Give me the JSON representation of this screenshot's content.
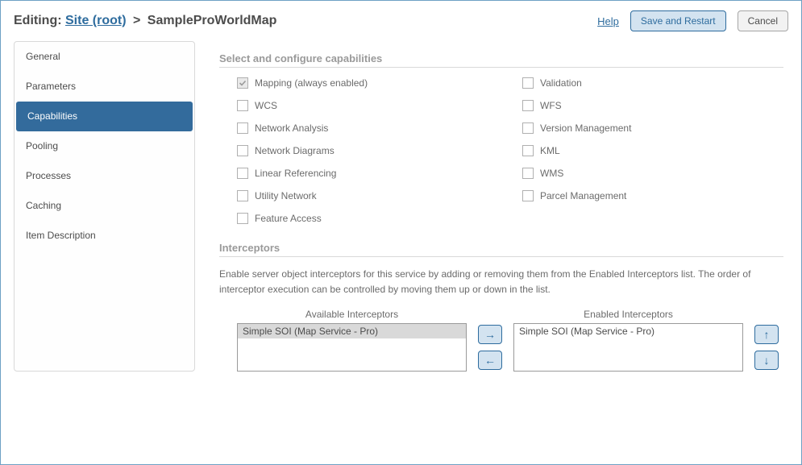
{
  "breadcrumb": {
    "prefix": "Editing:",
    "root_label": "Site (root)",
    "separator": ">",
    "current": "SampleProWorldMap"
  },
  "top": {
    "help": "Help",
    "save": "Save and Restart",
    "cancel": "Cancel"
  },
  "sidebar": {
    "items": [
      "General",
      "Parameters",
      "Capabilities",
      "Pooling",
      "Processes",
      "Caching",
      "Item Description"
    ],
    "active_index": 2
  },
  "capabilities": {
    "title": "Select and configure capabilities",
    "left": [
      {
        "label": "Mapping (always enabled)",
        "checked": true,
        "disabled": true
      },
      {
        "label": "WCS",
        "checked": false
      },
      {
        "label": "Network Analysis",
        "checked": false
      },
      {
        "label": "Network Diagrams",
        "checked": false
      },
      {
        "label": "Linear Referencing",
        "checked": false
      },
      {
        "label": "Utility Network",
        "checked": false
      },
      {
        "label": "Feature Access",
        "checked": false
      }
    ],
    "right": [
      {
        "label": "Validation",
        "checked": false
      },
      {
        "label": "WFS",
        "checked": false
      },
      {
        "label": "Version Management",
        "checked": false
      },
      {
        "label": "KML",
        "checked": false
      },
      {
        "label": "WMS",
        "checked": false
      },
      {
        "label": "Parcel Management",
        "checked": false
      }
    ]
  },
  "interceptors": {
    "title": "Interceptors",
    "description": "Enable server object interceptors for this service by adding or removing them from the Enabled Interceptors list. The order of interceptor execution can be controlled by moving them up or down in the list.",
    "available_label": "Available Interceptors",
    "enabled_label": "Enabled Interceptors",
    "available": [
      "Simple SOI (Map Service - Pro)"
    ],
    "enabled": [
      "Simple SOI (Map Service - Pro)"
    ],
    "arrows": {
      "right": "→",
      "left": "←",
      "up": "↑",
      "down": "↓"
    }
  }
}
